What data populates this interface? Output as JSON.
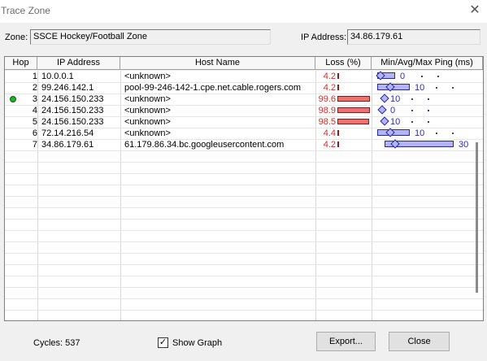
{
  "window": {
    "title": "Trace Zone",
    "close_glyph": "✕"
  },
  "zone": {
    "label": "Zone:",
    "value": "SSCE Hockey/Football Zone"
  },
  "ip": {
    "label": "IP Address:",
    "value": "34.86.179.61"
  },
  "columns": [
    "Hop",
    "IP Address",
    "Host Name",
    "Loss (%)",
    "Min/Avg/Max Ping (ms)"
  ],
  "rows": [
    {
      "hop": "1",
      "ip": "10.0.0.1",
      "host": "<unknown>",
      "loss": "4.2",
      "loss_pct": 4.2,
      "ping": "0",
      "ping_style": "bar",
      "min_ms": 0,
      "avg_ms": 0,
      "max_ms": 4,
      "status_dot": false
    },
    {
      "hop": "2",
      "ip": "99.246.142.1",
      "host": "pool-99-246-142-1.cpe.net.cable.rogers.com",
      "loss": "4.2",
      "loss_pct": 4.2,
      "ping": "10",
      "ping_style": "bar",
      "min_ms": 0,
      "avg_ms": 4,
      "max_ms": 10,
      "status_dot": false
    },
    {
      "hop": "3",
      "ip": "24.156.150.233",
      "host": "<unknown>",
      "loss": "99.6",
      "loss_pct": 99.6,
      "ping": "10",
      "ping_style": "diamond",
      "min_ms": 1,
      "avg_ms": 1,
      "max_ms": 1,
      "status_dot": true,
      "status_color": "#22b022"
    },
    {
      "hop": "4",
      "ip": "24.156.150.233",
      "host": "<unknown>",
      "loss": "98.9",
      "loss_pct": 98.9,
      "ping": "0",
      "ping_style": "diamond",
      "min_ms": 0,
      "avg_ms": 0,
      "max_ms": 0,
      "status_dot": false
    },
    {
      "hop": "5",
      "ip": "24.156.150.233",
      "host": "<unknown>",
      "loss": "98.5",
      "loss_pct": 98.5,
      "ping": "10",
      "ping_style": "diamond",
      "min_ms": 1,
      "avg_ms": 1,
      "max_ms": 1,
      "status_dot": false
    },
    {
      "hop": "6",
      "ip": "72.14.216.54",
      "host": "<unknown>",
      "loss": "4.4",
      "loss_pct": 4.4,
      "ping": "10",
      "ping_style": "bar",
      "min_ms": 0,
      "avg_ms": 4,
      "max_ms": 10,
      "status_dot": false
    },
    {
      "hop": "7",
      "ip": "34.86.179.61",
      "host": "61.179.86.34.bc.googleusercontent.com",
      "loss": "4.2",
      "loss_pct": 4.2,
      "ping": "30",
      "ping_style": "bar",
      "min_ms": 3,
      "avg_ms": 6,
      "max_ms": 28,
      "status_dot": false
    }
  ],
  "footer": {
    "cycles": "Cycles: 537",
    "show_graph_label": "Show Graph",
    "show_graph_checked": true,
    "check_glyph": "✓",
    "export_label": "Export...",
    "close_label": "Close"
  },
  "colors": {
    "loss_text": "#d03030",
    "loss_bar": "#f07070",
    "ping_fill": "#b4b4f4",
    "ping_border": "#2828a0",
    "ping_text": "#2b2bc4",
    "status_ok": "#22b022"
  }
}
